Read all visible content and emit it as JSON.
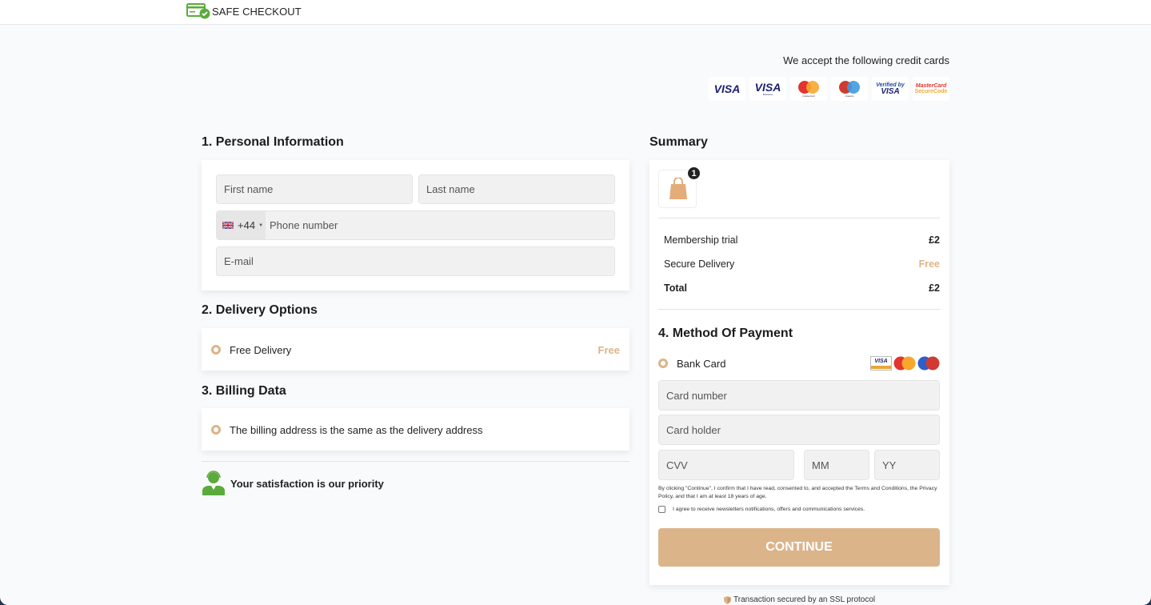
{
  "header": {
    "title": "SAFE CHECKOUT",
    "logo_icon": "card-check-icon"
  },
  "accepted_cards": {
    "label": "We accept the following credit cards",
    "logos": [
      "VISA",
      "VISA Business",
      "mastercard",
      "maestro",
      "Verified by VISA",
      "MasterCard SecureCode"
    ]
  },
  "personal": {
    "title": "1. Personal Information",
    "first_name_placeholder": "First name",
    "last_name_placeholder": "Last name",
    "phone_code": "+44",
    "phone_placeholder": "Phone number",
    "email_placeholder": "E-mail"
  },
  "delivery": {
    "title": "2. Delivery Options",
    "option": "Free Delivery",
    "price": "Free"
  },
  "billing": {
    "title": "3. Billing Data",
    "option": "The billing address is the same as the delivery address"
  },
  "satisfaction": {
    "text": "Your satisfaction is our priority"
  },
  "summary": {
    "title": "Summary",
    "cart_count": "1",
    "rows": [
      {
        "label": "Membership trial",
        "value": "£2"
      },
      {
        "label": "Secure Delivery",
        "value": "Free"
      },
      {
        "label": "Total",
        "value": "£2"
      }
    ]
  },
  "payment": {
    "title": "4. Method Of Payment",
    "option": "Bank Card",
    "card_number_placeholder": "Card number",
    "card_holder_placeholder": "Card holder",
    "cvv_placeholder": "CVV",
    "mm_placeholder": "MM",
    "yy_placeholder": "YY",
    "terms": "By clicking \"Continue\", I confirm that I have read, consented to, and accepted the Terms and Conditions, the Privacy Policy, and that I am at least 18 years of age.",
    "newsletter": "I agree to receive newsletters notifications, offers and communications services.",
    "continue_label": "CONTINUE"
  },
  "footer": {
    "ssl": "Transaction secured by an SSL protocol"
  },
  "colors": {
    "accent": "#dcb48a",
    "green": "#5aab3c"
  }
}
